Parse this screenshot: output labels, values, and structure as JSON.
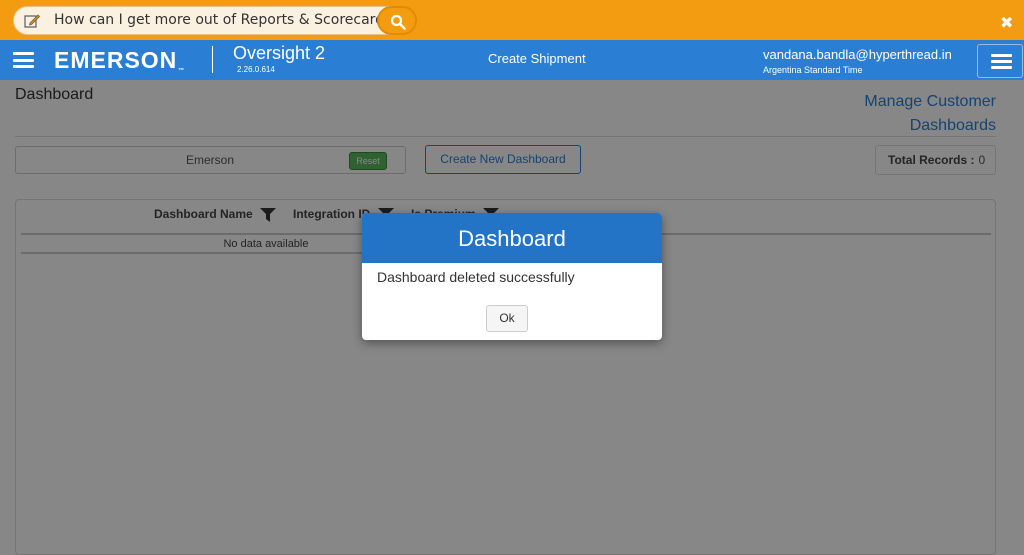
{
  "helpbar": {
    "question": "How can I get more out of Reports & Scorecards?",
    "close_glyph": "✖"
  },
  "header": {
    "brand": "EMERSON",
    "brand_tm": "™",
    "app_name": "Oversight 2",
    "version": "2.26.0.614",
    "create_shipment": "Create Shipment",
    "user_email": "vandana.bandla@hyperthread.in",
    "timezone": "Argentina Standard Time"
  },
  "page": {
    "title": "Dashboard",
    "manage_link_line1": "Manage Customer",
    "manage_link_line2": "Dashboards",
    "filter_value": "Emerson",
    "reset_label": "Reset",
    "new_dashboard_label": "Create New Dashboard",
    "total_records_label": "Total Records :",
    "total_records_value": "0"
  },
  "grid": {
    "columns": [
      "Dashboard Name",
      "Integration ID",
      "Is Premium"
    ],
    "empty_text": "No data available"
  },
  "modal": {
    "title": "Dashboard",
    "message": "Dashboard deleted successfully",
    "ok_label": "Ok"
  },
  "colors": {
    "helpbar": "#f39c12",
    "header": "#2a7fd4",
    "modal_header": "#2374c6",
    "reset_green": "#5cb85c"
  }
}
